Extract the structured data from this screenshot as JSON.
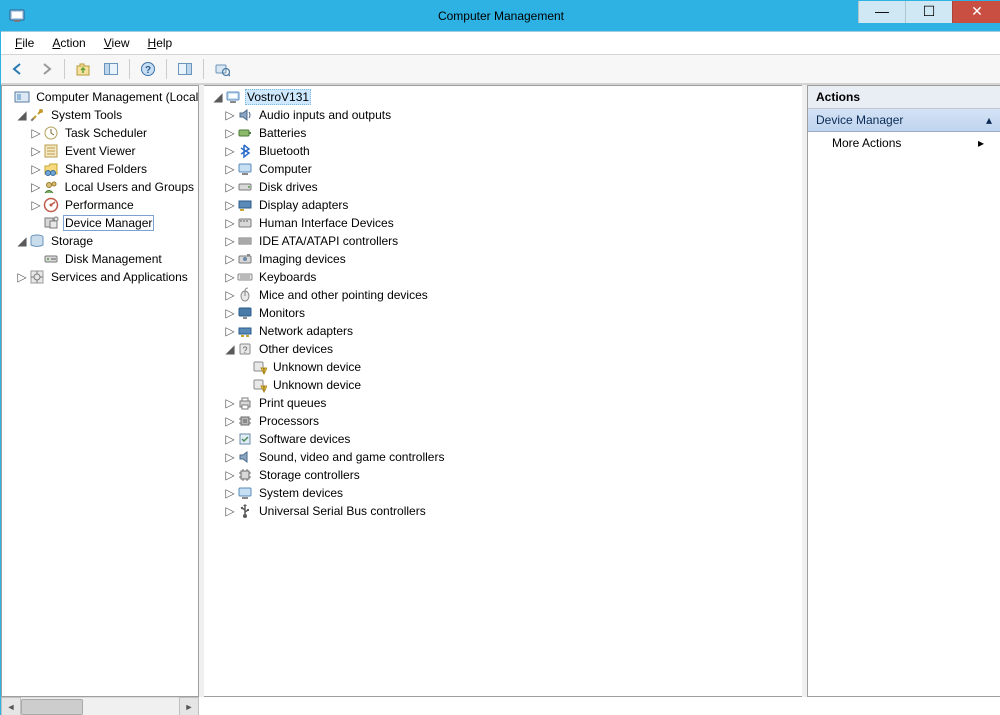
{
  "window": {
    "title": "Computer Management"
  },
  "menu": {
    "file": "File",
    "action": "Action",
    "view": "View",
    "help": "Help"
  },
  "left_tree": {
    "root": "Computer Management (Local",
    "system_tools": "System Tools",
    "task_scheduler": "Task Scheduler",
    "event_viewer": "Event Viewer",
    "shared_folders": "Shared Folders",
    "local_users": "Local Users and Groups",
    "performance": "Performance",
    "device_manager": "Device Manager",
    "storage": "Storage",
    "disk_management": "Disk Management",
    "services_apps": "Services and Applications"
  },
  "device_tree": {
    "root": "VostroV131",
    "items": [
      "Audio inputs and outputs",
      "Batteries",
      "Bluetooth",
      "Computer",
      "Disk drives",
      "Display adapters",
      "Human Interface Devices",
      "IDE ATA/ATAPI controllers",
      "Imaging devices",
      "Keyboards",
      "Mice and other pointing devices",
      "Monitors",
      "Network adapters"
    ],
    "other_devices": "Other devices",
    "unknown1": "Unknown device",
    "unknown2": "Unknown device",
    "items2": [
      "Print queues",
      "Processors",
      "Software devices",
      "Sound, video and game controllers",
      "Storage controllers",
      "System devices",
      "Universal Serial Bus controllers"
    ]
  },
  "actions": {
    "header": "Actions",
    "section": "Device Manager",
    "more": "More Actions"
  }
}
